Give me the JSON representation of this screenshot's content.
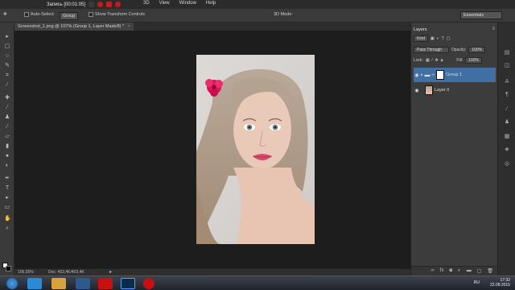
{
  "menubar": {
    "recording_label": "Запись [00:01:05]",
    "menus": [
      "3D",
      "View",
      "Window",
      "Help"
    ]
  },
  "options": {
    "auto_select_label": "Auto-Select:",
    "auto_select_value": "Group",
    "transform_label": "Show Transform Controls",
    "mode_label": "3D Mode:",
    "workspace": "Essentials"
  },
  "document": {
    "tab_title": "Screenshot_1.png @ 107% (Group 1, Layer Mask/8) *",
    "close_glyph": "×"
  },
  "status": {
    "zoom": "106,55%",
    "doc_size": "Doc: 403,4K/403,4K",
    "arrow": "▸"
  },
  "layers_panel": {
    "tab": "Layers",
    "kind_filter": "Kind",
    "blend_mode": "Pass Through",
    "opacity_label": "Opacity:",
    "opacity_value": "100%",
    "lock_label": "Lock:",
    "fill_label": "Fill:",
    "fill_value": "100%",
    "layers": [
      {
        "name": "Group 1",
        "selected": true
      },
      {
        "name": "Layer 0",
        "selected": false
      }
    ],
    "footer_icons": [
      "link-icon",
      "fx-icon",
      "mask-icon",
      "adjustment-icon",
      "folder-icon",
      "new-layer-icon",
      "trash-icon"
    ]
  },
  "taskbar": {
    "language": "RU",
    "time": "17:32",
    "date": "22.08.2015"
  },
  "colors": {
    "selected_layer": "#3f6fa3",
    "record_red": "#c41a1a",
    "flower": "#e0105a"
  }
}
